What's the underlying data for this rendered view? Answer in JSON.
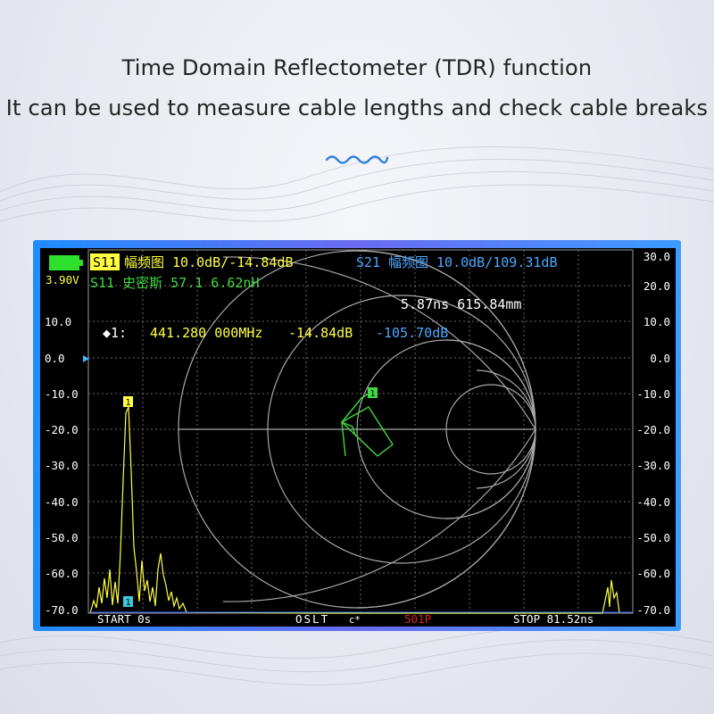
{
  "captions": {
    "line1": "Time Domain Reflectometer (TDR) function",
    "line2": "It can be used to measure cable lengths and check cable breaks"
  },
  "device": {
    "battery_voltage": "3.90V",
    "trace1": {
      "id": "S11",
      "label": "幅频图 10.0dB/-14.84dB",
      "color": "#ffff40"
    },
    "trace2": {
      "id": "S21",
      "label": "幅频图 10.0dB/109.31dB",
      "color": "#4aa8ff"
    },
    "smith_readout": "S11 史密斯  57.1  6.62nH",
    "tdr_readout": "5.87ns 615.84mm",
    "marker": {
      "index": "◆1:",
      "freq": "441.280 000MHz",
      "val1": "-14.84dB",
      "val2": "-105.70dB"
    },
    "left_scale": [
      "10.0",
      "0.0",
      "-10.0",
      "-20.0",
      "-30.0",
      "-40.0",
      "-50.0",
      "-60.0",
      "-70.0"
    ],
    "right_scale": [
      "30.0",
      "20.0",
      "10.0",
      "0.0",
      "-10.0",
      "-20.0",
      "-30.0",
      "-40.0",
      "-50.0",
      "-60.0",
      "-70.0"
    ],
    "footer": {
      "start": "START 0s",
      "cal": "OSLT",
      "cal_flag": "c*",
      "points": "501P",
      "stop": "STOP 81.52ns"
    },
    "marker_flag": "1"
  }
}
